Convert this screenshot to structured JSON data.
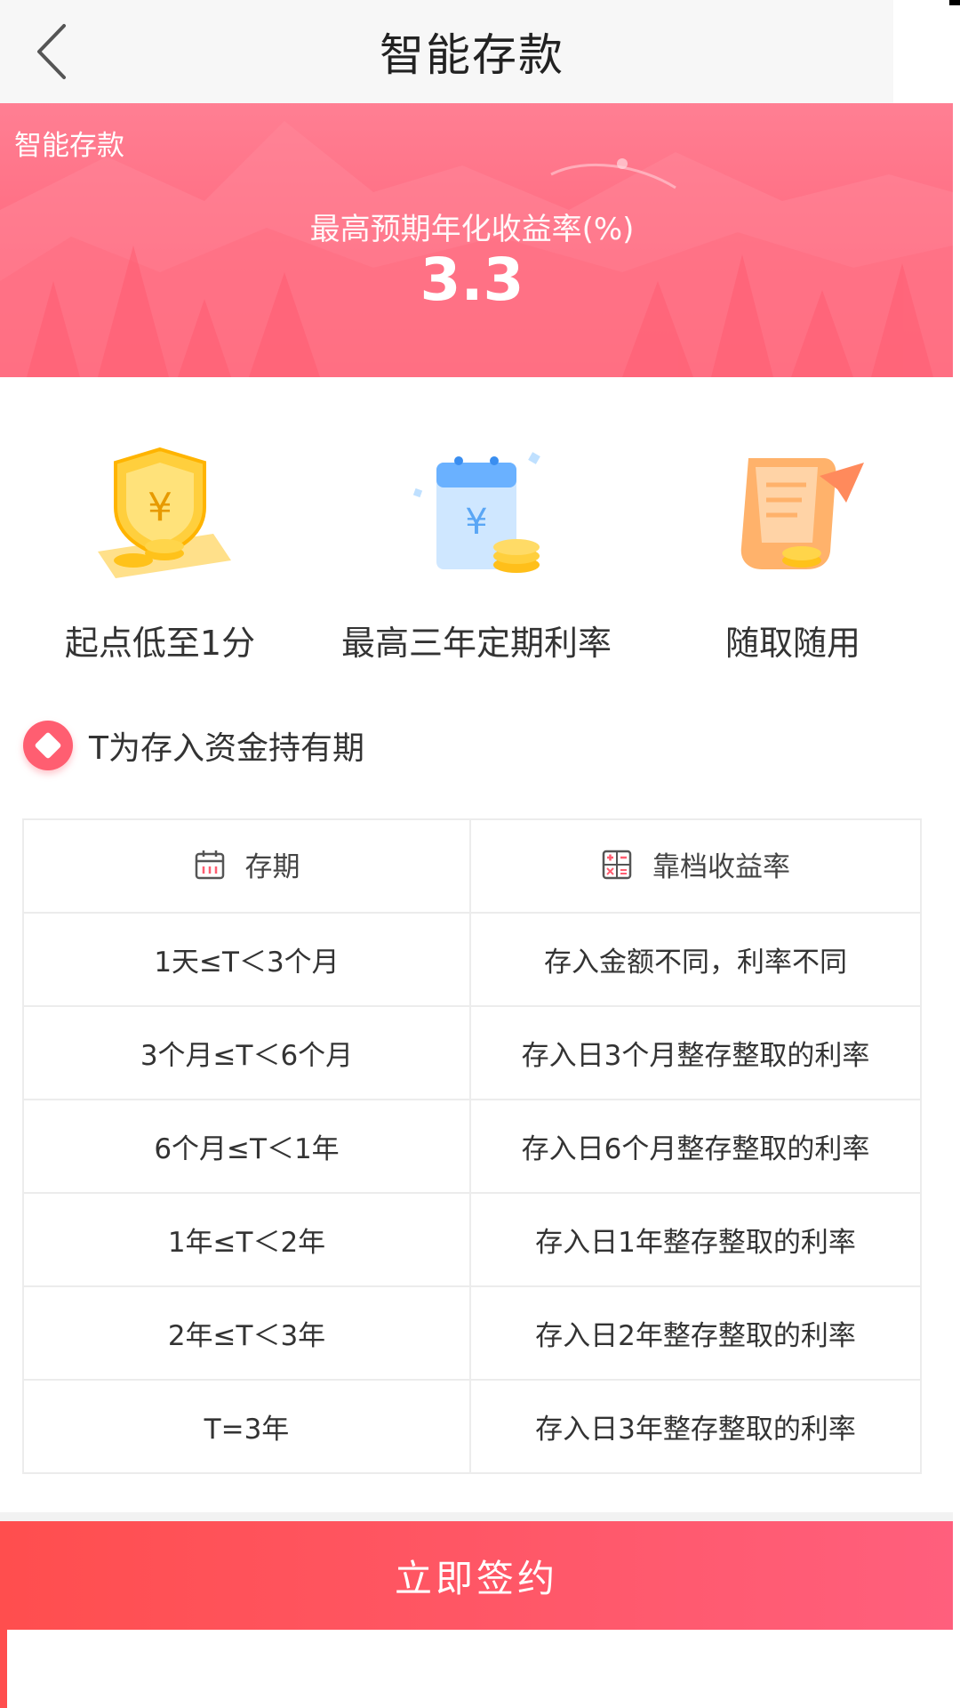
{
  "header": {
    "title": "智能存款",
    "back_icon": "chevron-left-icon"
  },
  "banner": {
    "tag": "智能存款",
    "subtitle": "最高预期年化收益率(%)",
    "rate": "3.3",
    "colors": {
      "top": "#ff7f93",
      "bottom": "#ff5f73"
    }
  },
  "features": [
    {
      "label": "起点低至1分",
      "icon": "shield-yuan-coins-icon"
    },
    {
      "label": "最高三年定期利率",
      "icon": "calendar-yuan-coins-icon"
    },
    {
      "label": "随取随用",
      "icon": "paper-plane-scroll-icon"
    }
  ],
  "note": {
    "text": "T为存入资金持有期",
    "icon": "diamond-badge-icon"
  },
  "table": {
    "headers": [
      {
        "label": "存期",
        "icon": "calendar-icon"
      },
      {
        "label": "靠档收益率",
        "icon": "calculator-icon"
      }
    ],
    "rows": [
      {
        "term": "1天≤T＜3个月",
        "rate": "存入金额不同，利率不同"
      },
      {
        "term": "3个月≤T＜6个月",
        "rate": "存入日3个月整存整取的利率"
      },
      {
        "term": "6个月≤T＜1年",
        "rate": "存入日6个月整存整取的利率"
      },
      {
        "term": "1年≤T＜2年",
        "rate": "存入日1年整存整取的利率"
      },
      {
        "term": "2年≤T＜3年",
        "rate": "存入日2年整存整取的利率"
      },
      {
        "term": "T=3年",
        "rate": "存入日3年整存整取的利率"
      }
    ]
  },
  "cta": {
    "label": "立即签约",
    "colors": {
      "start": "#ff4e4e",
      "end": "#ff5f7d"
    }
  }
}
